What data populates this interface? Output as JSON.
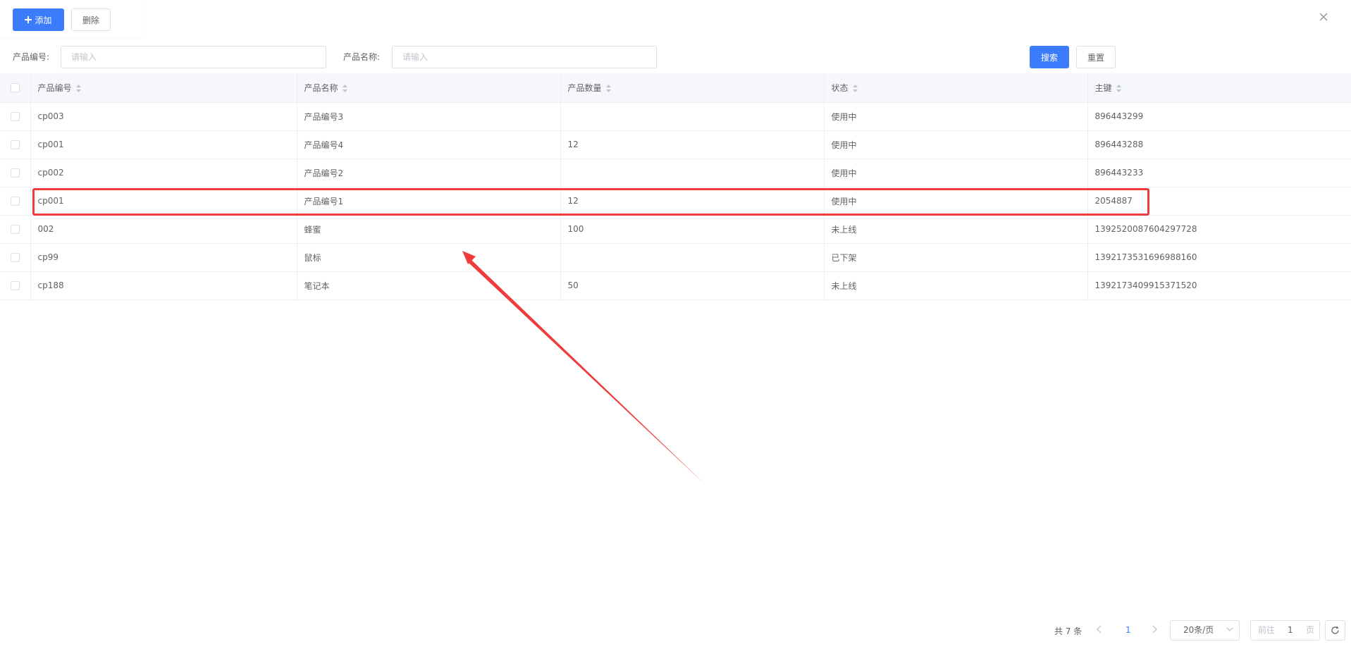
{
  "toolbar": {
    "add_label": "添加",
    "delete_label": "删除"
  },
  "search": {
    "code_label": "产品编号:",
    "code_placeholder": "请输入",
    "name_label": "产品名称:",
    "name_placeholder": "请输入",
    "search_label": "搜索",
    "reset_label": "重置"
  },
  "table": {
    "columns": [
      "产品编号",
      "产品名称",
      "产品数量",
      "状态",
      "主键"
    ],
    "rows": [
      {
        "code": "cp003",
        "name": "产品编号3",
        "qty": "",
        "status": "使用中",
        "key": "896443299"
      },
      {
        "code": "cp001",
        "name": "产品编号4",
        "qty": "12",
        "status": "使用中",
        "key": "896443288"
      },
      {
        "code": "cp002",
        "name": "产品编号2",
        "qty": "",
        "status": "使用中",
        "key": "896443233"
      },
      {
        "code": "cp001",
        "name": "产品编号1",
        "qty": "12",
        "status": "使用中",
        "key": "2054887"
      },
      {
        "code": "002",
        "name": "蜂蜜",
        "qty": "100",
        "status": "未上线",
        "key": "1392520087604297728"
      },
      {
        "code": "cp99",
        "name": "鼠标",
        "qty": "",
        "status": "已下架",
        "key": "1392173531696988160"
      },
      {
        "code": "cp188",
        "name": "笔记本",
        "qty": "50",
        "status": "未上线",
        "key": "1392173409915371520"
      }
    ]
  },
  "pager": {
    "total": "共 7 条",
    "current_page": "1",
    "page_size": "20条/页",
    "goto_prefix": "前往",
    "goto_value": "1",
    "goto_suffix": "页"
  },
  "colors": {
    "primary": "#3a7cfb",
    "annotation": "#ef3b3b"
  }
}
